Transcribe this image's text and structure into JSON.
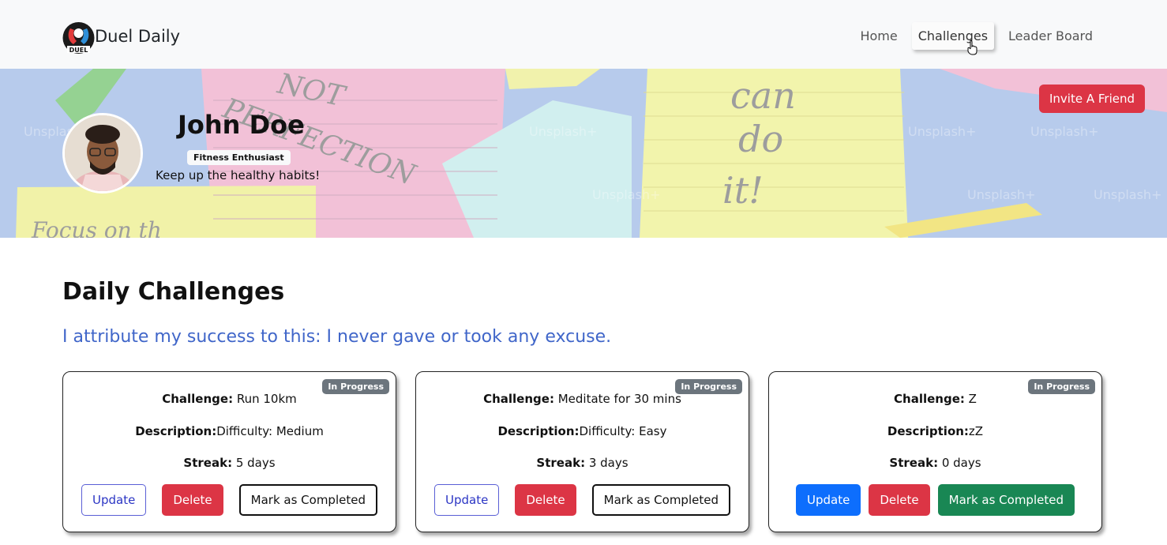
{
  "nav": {
    "brand": "Duel Daily",
    "logo_text": "DUEL",
    "links": [
      "Home",
      "Challenges",
      "Leader Board"
    ],
    "active": "Challenges"
  },
  "hero": {
    "name": "John Doe",
    "badge": "Fitness Enthusiast",
    "tagline": "Keep up the healthy habits!",
    "invite_label": "Invite A Friend",
    "background_text": [
      "NOT",
      "PERFECTION",
      "can",
      "do",
      "it!",
      "Focus on th"
    ],
    "watermark": "Unsplash+"
  },
  "main": {
    "title": "Daily Challenges",
    "quote": "I attribute my success to this: I never gave or took any excuse."
  },
  "labels": {
    "challenge": "Challenge:",
    "description": "Description:",
    "streak": "Streak:",
    "update": "Update",
    "delete": "Delete",
    "mark_completed": "Mark as Completed"
  },
  "cards": [
    {
      "status": "In Progress",
      "challenge": "Run 10km",
      "description": "Difficulty: Medium",
      "streak": "5 days"
    },
    {
      "status": "In Progress",
      "challenge": "Meditate for 30 mins",
      "description": "Difficulty: Easy",
      "streak": "3 days"
    },
    {
      "status": "In Progress",
      "challenge": "Z",
      "description": "zZ",
      "streak": "0 days"
    }
  ],
  "colors": {
    "danger": "#dc3545",
    "primary": "#0d6efd",
    "success": "#198754",
    "secondary": "#6c757d",
    "quote": "#4066c9"
  }
}
